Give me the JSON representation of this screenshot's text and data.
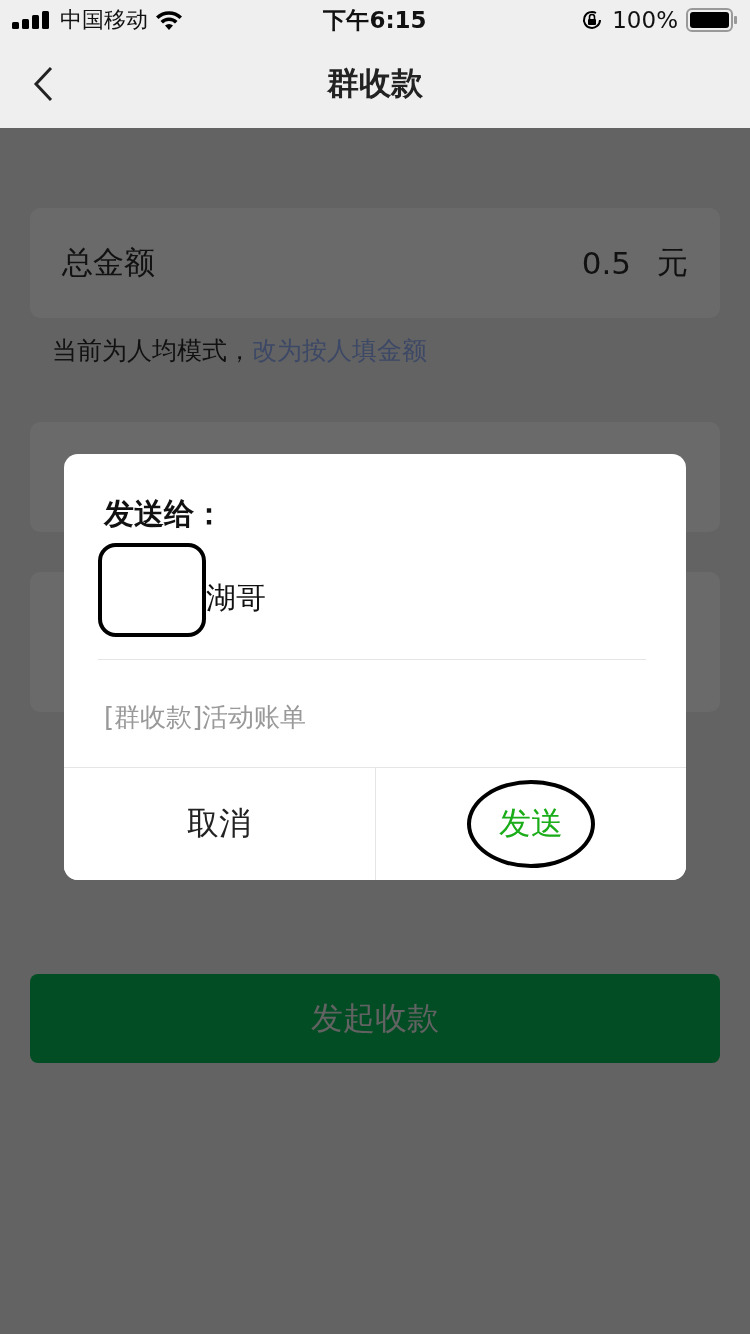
{
  "status_bar": {
    "carrier": "中国移动",
    "time": "下午6:15",
    "battery": "100%"
  },
  "nav": {
    "title": "群收款"
  },
  "total": {
    "label": "总金额",
    "amount": "0.5",
    "unit": "元"
  },
  "mode_note": {
    "text": "当前为人均模式，",
    "link": "改为按人填金额"
  },
  "submit_button": "发起收款",
  "dialog": {
    "title": "发送给：",
    "recipient": "湖哥",
    "message": "[群收款]活动账单",
    "buttons": [
      {
        "label": "取消",
        "kind": "cancel",
        "circled": false
      },
      {
        "label": "发送",
        "kind": "primary",
        "circled": true
      }
    ]
  }
}
